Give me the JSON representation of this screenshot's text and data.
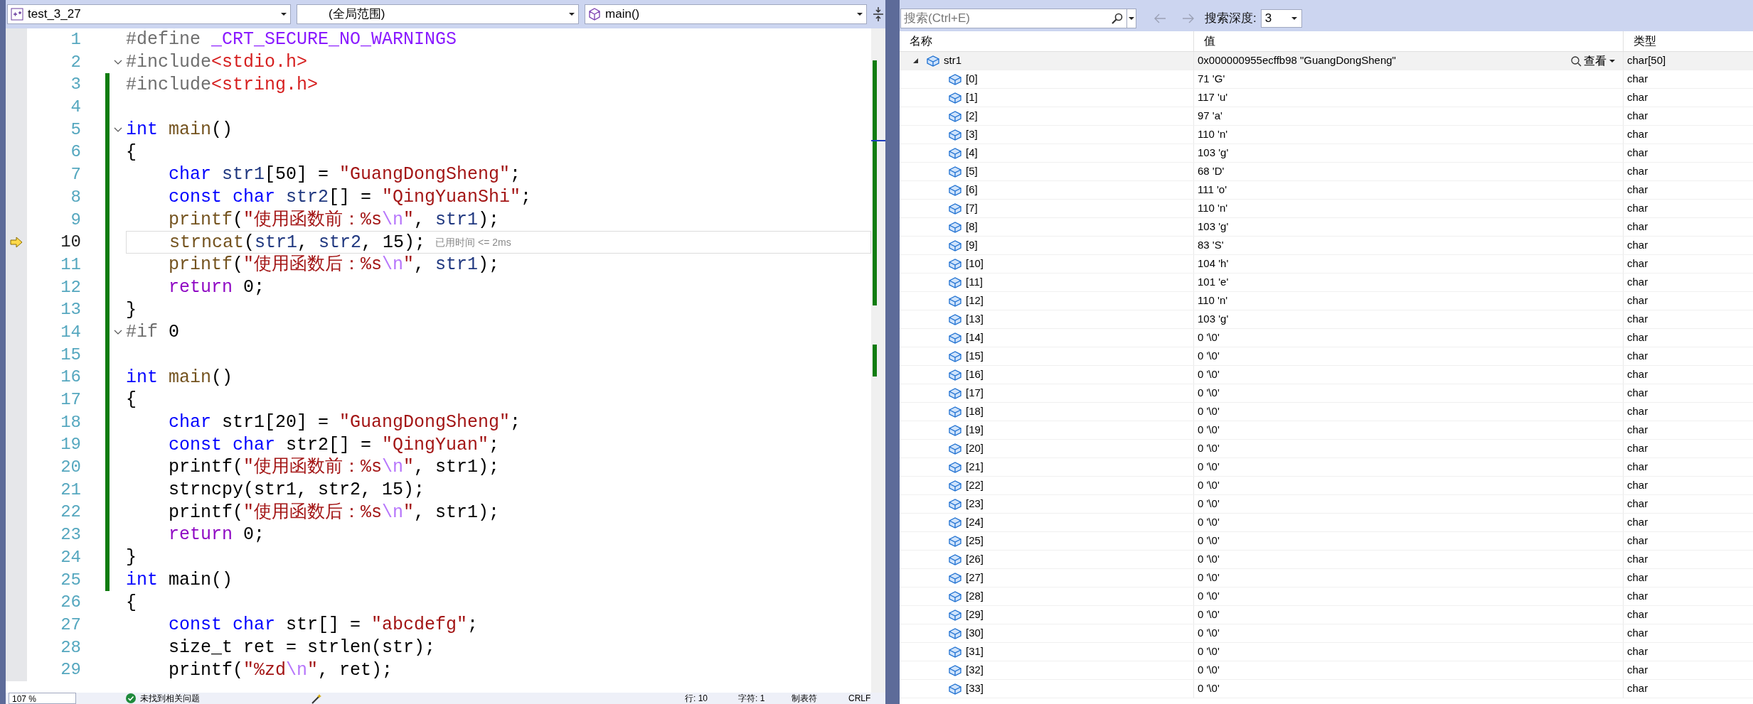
{
  "editor_toolbar": {
    "project": "test_3_27",
    "scope": "(全局范围)",
    "member": "main()"
  },
  "editor": {
    "lines": [
      {
        "number": "1",
        "changed": false,
        "fold": false,
        "current": false,
        "indented": false,
        "tokens": [
          {
            "kind": "pre",
            "text": "#define "
          },
          {
            "kind": "macro",
            "text": "_CRT_SECURE_NO_WARNINGS"
          }
        ]
      },
      {
        "number": "2",
        "changed": false,
        "fold": true,
        "current": false,
        "indented": false,
        "tokens": [
          {
            "kind": "pre",
            "text": "#include"
          },
          {
            "kind": "header",
            "text": "<stdio.h>"
          }
        ]
      },
      {
        "number": "3",
        "changed": true,
        "fold": false,
        "current": false,
        "indented": false,
        "tokens": [
          {
            "kind": "pre",
            "text": "#include"
          },
          {
            "kind": "header",
            "text": "<string.h>"
          }
        ]
      },
      {
        "number": "4",
        "changed": true,
        "fold": false,
        "current": false,
        "indented": false
      },
      {
        "number": "5",
        "changed": true,
        "fold": true,
        "current": false,
        "indented": false,
        "tokens": [
          {
            "kind": "kw",
            "text": "int "
          },
          {
            "kind": "fn",
            "text": "main"
          },
          {
            "kind": "plain",
            "text": "()"
          }
        ]
      },
      {
        "number": "6",
        "changed": true,
        "fold": false,
        "current": false,
        "indented": false,
        "tokens": [
          {
            "kind": "plain",
            "text": "{"
          }
        ]
      },
      {
        "number": "7",
        "changed": true,
        "fold": false,
        "current": false,
        "indented": true,
        "tokens": [
          {
            "kind": "kw",
            "text": "char "
          },
          {
            "kind": "var",
            "text": "str1"
          },
          {
            "kind": "plain",
            "text": "[50] = "
          },
          {
            "kind": "str",
            "text": "\"GuangDongSheng\""
          },
          {
            "kind": "plain",
            "text": ";"
          }
        ]
      },
      {
        "number": "8",
        "changed": true,
        "fold": false,
        "current": false,
        "indented": true,
        "tokens": [
          {
            "kind": "kw",
            "text": "const char "
          },
          {
            "kind": "var",
            "text": "str2"
          },
          {
            "kind": "plain",
            "text": "[] = "
          },
          {
            "kind": "str",
            "text": "\"QingYuanShi\""
          },
          {
            "kind": "plain",
            "text": ";"
          }
        ]
      },
      {
        "number": "9",
        "changed": true,
        "fold": false,
        "current": false,
        "indented": true,
        "tokens": [
          {
            "kind": "fn",
            "text": "printf"
          },
          {
            "kind": "plain",
            "text": "("
          },
          {
            "kind": "str",
            "text": "\"使用函数前：%s"
          },
          {
            "kind": "esc",
            "text": "\\n"
          },
          {
            "kind": "str",
            "text": "\""
          },
          {
            "kind": "plain",
            "text": ", "
          },
          {
            "kind": "var",
            "text": "str1"
          },
          {
            "kind": "plain",
            "text": ");"
          }
        ]
      },
      {
        "number": "10",
        "changed": true,
        "fold": false,
        "current": true,
        "indented": true,
        "hint": "已用时间 <= 2ms",
        "tokens": [
          {
            "kind": "fn",
            "text": "strncat"
          },
          {
            "kind": "plain",
            "text": "("
          },
          {
            "kind": "var",
            "text": "str1"
          },
          {
            "kind": "plain",
            "text": ", "
          },
          {
            "kind": "var",
            "text": "str2"
          },
          {
            "kind": "plain",
            "text": ", 15);"
          }
        ]
      },
      {
        "number": "11",
        "changed": true,
        "fold": false,
        "current": false,
        "indented": true,
        "tokens": [
          {
            "kind": "fn",
            "text": "printf"
          },
          {
            "kind": "plain",
            "text": "("
          },
          {
            "kind": "str",
            "text": "\"使用函数后：%s"
          },
          {
            "kind": "esc",
            "text": "\\n"
          },
          {
            "kind": "str",
            "text": "\""
          },
          {
            "kind": "plain",
            "text": ", "
          },
          {
            "kind": "var",
            "text": "str1"
          },
          {
            "kind": "plain",
            "text": ");"
          }
        ]
      },
      {
        "number": "12",
        "changed": true,
        "fold": false,
        "current": false,
        "indented": true,
        "tokens": [
          {
            "kind": "ctrl",
            "text": "return"
          },
          {
            "kind": "plain",
            "text": " 0;"
          }
        ]
      },
      {
        "number": "13",
        "changed": true,
        "fold": false,
        "current": false,
        "indented": false,
        "tokens": [
          {
            "kind": "plain",
            "text": "}"
          }
        ]
      },
      {
        "number": "14",
        "changed": true,
        "fold": true,
        "current": false,
        "indented": false,
        "tokens": [
          {
            "kind": "pre",
            "text": "#if"
          },
          {
            "kind": "plain",
            "text": " 0"
          }
        ]
      },
      {
        "number": "15",
        "changed": true,
        "fold": false,
        "current": false,
        "indented": false
      },
      {
        "number": "16",
        "changed": true,
        "fold": false,
        "current": false,
        "indented": false,
        "tokens": [
          {
            "kind": "kw",
            "text": "int "
          },
          {
            "kind": "fn",
            "text": "main"
          },
          {
            "kind": "plain",
            "text": "()"
          }
        ]
      },
      {
        "number": "17",
        "changed": true,
        "fold": false,
        "current": false,
        "indented": false,
        "tokens": [
          {
            "kind": "plain",
            "text": "{"
          }
        ]
      },
      {
        "number": "18",
        "changed": true,
        "fold": false,
        "current": false,
        "indented": true,
        "tokens": [
          {
            "kind": "kw",
            "text": "char"
          },
          {
            "kind": "plain",
            "text": " str1[20] = "
          },
          {
            "kind": "str",
            "text": "\"GuangDongSheng\""
          },
          {
            "kind": "plain",
            "text": ";"
          }
        ]
      },
      {
        "number": "19",
        "changed": true,
        "fold": false,
        "current": false,
        "indented": true,
        "tokens": [
          {
            "kind": "kw",
            "text": "const char"
          },
          {
            "kind": "plain",
            "text": " str2[] = "
          },
          {
            "kind": "str",
            "text": "\"QingYuan\""
          },
          {
            "kind": "plain",
            "text": ";"
          }
        ]
      },
      {
        "number": "20",
        "changed": true,
        "fold": false,
        "current": false,
        "indented": true,
        "tokens": [
          {
            "kind": "plain",
            "text": "printf("
          },
          {
            "kind": "str",
            "text": "\"使用函数前：%s"
          },
          {
            "kind": "esc",
            "text": "\\n"
          },
          {
            "kind": "str",
            "text": "\""
          },
          {
            "kind": "plain",
            "text": ", str1);"
          }
        ]
      },
      {
        "number": "21",
        "changed": true,
        "fold": false,
        "current": false,
        "indented": true,
        "tokens": [
          {
            "kind": "plain",
            "text": "strncpy(str1, str2, 15);"
          }
        ]
      },
      {
        "number": "22",
        "changed": true,
        "fold": false,
        "current": false,
        "indented": true,
        "tokens": [
          {
            "kind": "plain",
            "text": "printf("
          },
          {
            "kind": "str",
            "text": "\"使用函数后：%s"
          },
          {
            "kind": "esc",
            "text": "\\n"
          },
          {
            "kind": "str",
            "text": "\""
          },
          {
            "kind": "plain",
            "text": ", str1);"
          }
        ]
      },
      {
        "number": "23",
        "changed": true,
        "fold": false,
        "current": false,
        "indented": true,
        "tokens": [
          {
            "kind": "ctrl",
            "text": "return"
          },
          {
            "kind": "plain",
            "text": " 0;"
          }
        ]
      },
      {
        "number": "24",
        "changed": true,
        "fold": false,
        "current": false,
        "indented": false,
        "tokens": [
          {
            "kind": "plain",
            "text": "}"
          }
        ]
      },
      {
        "number": "25",
        "changed": true,
        "fold": false,
        "current": false,
        "indented": false,
        "tokens": [
          {
            "kind": "kw",
            "text": "int"
          },
          {
            "kind": "plain",
            "text": " main()"
          }
        ]
      },
      {
        "number": "26",
        "changed": false,
        "fold": false,
        "current": false,
        "indented": false,
        "tokens": [
          {
            "kind": "plain",
            "text": "{"
          }
        ]
      },
      {
        "number": "27",
        "changed": false,
        "fold": false,
        "current": false,
        "indented": true,
        "tokens": [
          {
            "kind": "kw",
            "text": "const char"
          },
          {
            "kind": "plain",
            "text": " str[] = "
          },
          {
            "kind": "str",
            "text": "\"abcdefg\""
          },
          {
            "kind": "plain",
            "text": ";"
          }
        ]
      },
      {
        "number": "28",
        "changed": false,
        "fold": false,
        "current": false,
        "indented": true,
        "tokens": [
          {
            "kind": "plain",
            "text": "size_t ret = strlen(str);"
          }
        ]
      },
      {
        "number": "29",
        "changed": false,
        "fold": false,
        "current": false,
        "indented": true,
        "tokens": [
          {
            "kind": "plain",
            "text": "printf("
          },
          {
            "kind": "str",
            "text": "\"%zd"
          },
          {
            "kind": "esc",
            "text": "\\n"
          },
          {
            "kind": "str",
            "text": "\""
          },
          {
            "kind": "plain",
            "text": ", ret);"
          }
        ]
      }
    ]
  },
  "status_bar": {
    "zoom": "107 %",
    "issues": "未找到相关问题",
    "line": "行: 10",
    "char": "字符: 1",
    "indent": "制表符",
    "eol": "CRLF"
  },
  "watch": {
    "search": {
      "placeholder": "搜索(Ctrl+E)"
    },
    "depth_label": "搜索深度:",
    "depth": "3",
    "columns": [
      "名称",
      "值",
      "类型"
    ],
    "rows": [
      {
        "name": "str1",
        "value": "0x000000955ecffb98 \"GuangDongSheng\"",
        "view_label": "查看",
        "type": "char[50]",
        "expanded": true,
        "children": [
          {
            "name": "[0]",
            "value": "71 'G'",
            "type": "char"
          },
          {
            "name": "[1]",
            "value": "117 'u'",
            "type": "char"
          },
          {
            "name": "[2]",
            "value": "97 'a'",
            "type": "char"
          },
          {
            "name": "[3]",
            "value": "110 'n'",
            "type": "char"
          },
          {
            "name": "[4]",
            "value": "103 'g'",
            "type": "char"
          },
          {
            "name": "[5]",
            "value": "68 'D'",
            "type": "char"
          },
          {
            "name": "[6]",
            "value": "111 'o'",
            "type": "char"
          },
          {
            "name": "[7]",
            "value": "110 'n'",
            "type": "char"
          },
          {
            "name": "[8]",
            "value": "103 'g'",
            "type": "char"
          },
          {
            "name": "[9]",
            "value": "83 'S'",
            "type": "char"
          },
          {
            "name": "[10]",
            "value": "104 'h'",
            "type": "char"
          },
          {
            "name": "[11]",
            "value": "101 'e'",
            "type": "char"
          },
          {
            "name": "[12]",
            "value": "110 'n'",
            "type": "char"
          },
          {
            "name": "[13]",
            "value": "103 'g'",
            "type": "char"
          },
          {
            "name": "[14]",
            "value": "0 '\\0'",
            "type": "char"
          },
          {
            "name": "[15]",
            "value": "0 '\\0'",
            "type": "char"
          },
          {
            "name": "[16]",
            "value": "0 '\\0'",
            "type": "char"
          },
          {
            "name": "[17]",
            "value": "0 '\\0'",
            "type": "char"
          },
          {
            "name": "[18]",
            "value": "0 '\\0'",
            "type": "char"
          },
          {
            "name": "[19]",
            "value": "0 '\\0'",
            "type": "char"
          },
          {
            "name": "[20]",
            "value": "0 '\\0'",
            "type": "char"
          },
          {
            "name": "[21]",
            "value": "0 '\\0'",
            "type": "char"
          },
          {
            "name": "[22]",
            "value": "0 '\\0'",
            "type": "char"
          },
          {
            "name": "[23]",
            "value": "0 '\\0'",
            "type": "char"
          },
          {
            "name": "[24]",
            "value": "0 '\\0'",
            "type": "char"
          },
          {
            "name": "[25]",
            "value": "0 '\\0'",
            "type": "char"
          },
          {
            "name": "[26]",
            "value": "0 '\\0'",
            "type": "char"
          },
          {
            "name": "[27]",
            "value": "0 '\\0'",
            "type": "char"
          },
          {
            "name": "[28]",
            "value": "0 '\\0'",
            "type": "char"
          },
          {
            "name": "[29]",
            "value": "0 '\\0'",
            "type": "char"
          },
          {
            "name": "[30]",
            "value": "0 '\\0'",
            "type": "char"
          },
          {
            "name": "[31]",
            "value": "0 '\\0'",
            "type": "char"
          },
          {
            "name": "[32]",
            "value": "0 '\\0'",
            "type": "char"
          },
          {
            "name": "[33]",
            "value": "0 '\\0'",
            "type": "char"
          }
        ]
      }
    ]
  }
}
